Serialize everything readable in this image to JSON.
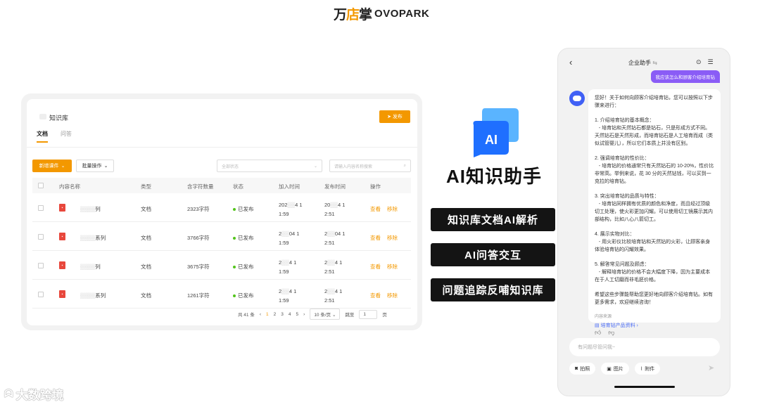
{
  "brand": {
    "logo_cn_a": "万",
    "logo_cn_b": "店",
    "logo_cn_c": "掌",
    "logo_en": "OVOPARK"
  },
  "kb": {
    "title": "知识库",
    "publish_btn": "发布",
    "tabs": [
      "文档",
      "问答"
    ],
    "new_btn": "新增课件",
    "batch_btn": "批量操作",
    "status_placeholder": "全部状态",
    "search_placeholder": "请输入内容名称搜索",
    "columns": [
      "内容名称",
      "类型",
      "含字符数量",
      "状态",
      "加入时间",
      "发布时间",
      "操作"
    ],
    "rows": [
      {
        "name": "列",
        "type": "文档",
        "chars": "2323字符",
        "status": "已发布",
        "add_a": "202",
        "add_b": "4 1",
        "add_c": "1:59",
        "pub_a": "20",
        "pub_b": "4 1",
        "pub_c": "2:51",
        "view": "查看",
        "move": "移除"
      },
      {
        "name": "系列",
        "type": "文档",
        "chars": "3766字符",
        "status": "已发布",
        "add_a": "2",
        "add_b": "04 1",
        "add_c": "1:59",
        "pub_a": "2",
        "pub_b": "04 1",
        "pub_c": "2:51",
        "view": "查看",
        "move": "移除"
      },
      {
        "name": "列",
        "type": "文档",
        "chars": "3675字符",
        "status": "已发布",
        "add_a": "2",
        "add_b": "4 1",
        "add_c": "1:59",
        "pub_a": "2",
        "pub_b": "4 1",
        "pub_c": "2:51",
        "view": "查看",
        "move": "移除"
      },
      {
        "name": "系列",
        "type": "文档",
        "chars": "1261字符",
        "status": "已发布",
        "add_a": "2",
        "add_b": "4 1",
        "add_c": "1:59",
        "pub_a": "2",
        "pub_b": "4 1",
        "pub_c": "2:51",
        "view": "查看",
        "move": "移除"
      }
    ],
    "pager": {
      "total": "共 41 条",
      "pages": [
        "1",
        "2",
        "3",
        "4",
        "5"
      ],
      "page_size": "10 条/页",
      "jump": "跳至",
      "jump_value": "1",
      "page_unit": "页"
    }
  },
  "center": {
    "icon_text": "AI",
    "title": "AI知识助手",
    "features": [
      "知识库文档AI解析",
      "AI问答交互",
      "问题追踪反哺知识库"
    ]
  },
  "phone": {
    "title": "企业助手",
    "user_msg": "我应该怎么和顾客介绍培育钻",
    "answer": [
      "您好！关于如何向顾客介绍培育钻，您可以按照以下步骤来进行：",
      "1. 介绍培育钻的基本概念：\n   - 培育钻和天然钻石都是钻石，只是形成方式不同。天然钻石是天然形成，而培育钻石是人工培育而成（类似试管婴儿），所以它们本质上并没有区别。",
      "2. 强调培育钻的性价比：\n   - 培育钻的价格通常只有天然钻石的 10-20%，性价比非常高。举例来说，花 30 分的天然钻钱，可以买到一克拉的培育钻。",
      "3. 突出培育钻的品质与特性：\n   - 培育钻同样拥有优质的颜色和净度，而且经过顶级切工处理，使火彩更加闪耀。可以使用切工镜展示其内部结构，比如八心八箭切工。",
      "4. 展示实物对比：\n   - 用火彩仪比较培育钻和天然钻的火彩，让顾客亲身体验培育钻的闪耀效果。",
      "5. 解答常见问题及顾虑：\n   - 解释培育钻的价格不会大幅度下降，因为主要成本在于人工切磨而非毛胚价格。",
      "希望这些步骤能帮助您更好地向顾客介绍培育钻。如有更多需求，欢迎继续咨询！"
    ],
    "source_label": "内容来源",
    "source_link": "培育钻产品资料",
    "input_placeholder": "有问题尽管问我~",
    "tools": [
      "拍照",
      "图片",
      "附件"
    ]
  },
  "watermark": "大数跨境"
}
